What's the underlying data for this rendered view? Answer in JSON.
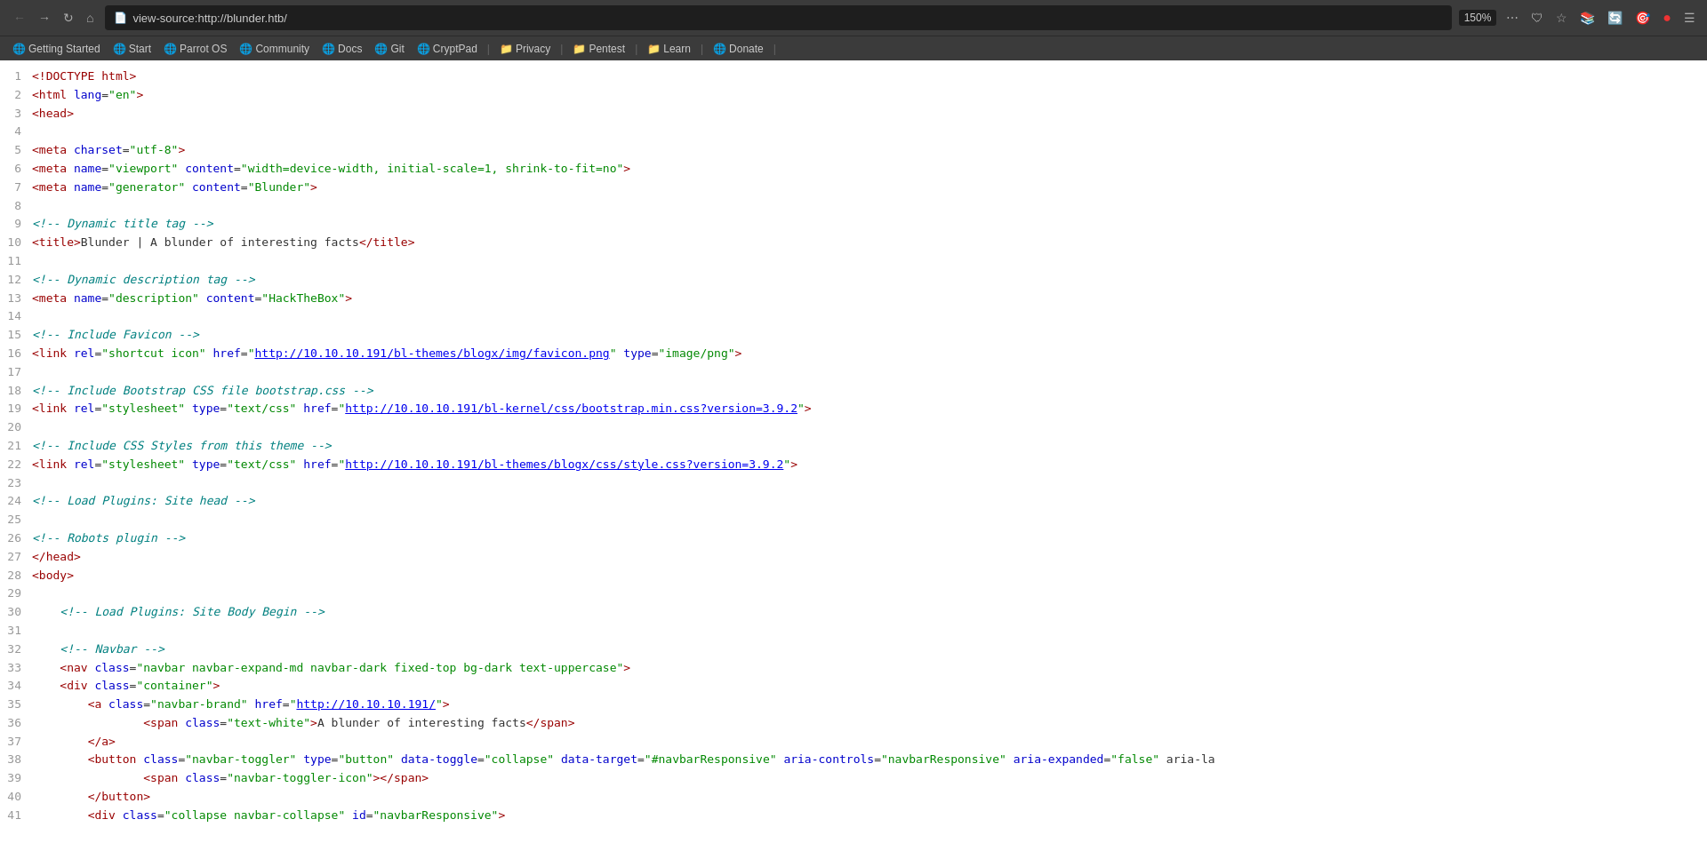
{
  "browser": {
    "address": "view-source:http://blunder.htb/",
    "zoom": "150%",
    "bookmarks": [
      {
        "label": "Getting Started",
        "icon": "🌐"
      },
      {
        "label": "Start",
        "icon": "🌐"
      },
      {
        "label": "Parrot OS",
        "icon": "🌐"
      },
      {
        "label": "Community",
        "icon": "🌐"
      },
      {
        "label": "Docs",
        "icon": "🌐"
      },
      {
        "label": "Git",
        "icon": "🌐"
      },
      {
        "label": "CryptPad",
        "icon": "🌐"
      },
      {
        "separator": true
      },
      {
        "label": "Privacy",
        "icon": "📁"
      },
      {
        "separator": true
      },
      {
        "label": "Pentest",
        "icon": "📁"
      },
      {
        "separator": true
      },
      {
        "label": "Learn",
        "icon": "📁"
      },
      {
        "separator": true
      },
      {
        "label": "Donate",
        "icon": "🌐"
      },
      {
        "separator2": true
      }
    ]
  },
  "source_lines": [
    {
      "n": 1,
      "html": "<span class='doctype'>&lt;!DOCTYPE html&gt;</span>"
    },
    {
      "n": 2,
      "html": "<span class='tag'>&lt;html</span> <span class='attr-name'>lang</span>=<span class='attr-value'>\"en\"</span><span class='tag'>&gt;</span>"
    },
    {
      "n": 3,
      "html": "<span class='tag'>&lt;head&gt;</span>"
    },
    {
      "n": 4,
      "html": ""
    },
    {
      "n": 5,
      "html": "<span class='tag'>&lt;meta</span> <span class='attr-name'>charset</span>=<span class='attr-value'>\"utf-8\"</span><span class='tag'>&gt;</span>"
    },
    {
      "n": 6,
      "html": "<span class='tag'>&lt;meta</span> <span class='attr-name'>name</span>=<span class='attr-value'>\"viewport\"</span> <span class='attr-name'>content</span>=<span class='attr-value'>\"width=device-width, initial-scale=1, shrink-to-fit=no\"</span><span class='tag'>&gt;</span>"
    },
    {
      "n": 7,
      "html": "<span class='tag'>&lt;meta</span> <span class='attr-name'>name</span>=<span class='attr-value'>\"generator\"</span> <span class='attr-name'>content</span>=<span class='attr-value'>\"Blunder\"</span><span class='tag'>&gt;</span>"
    },
    {
      "n": 8,
      "html": ""
    },
    {
      "n": 9,
      "html": "<span class='comment'>&lt;!-- Dynamic title tag --&gt;</span>"
    },
    {
      "n": 10,
      "html": "<span class='tag'>&lt;title&gt;</span>Blunder | A blunder of interesting facts<span class='tag'>&lt;/title&gt;</span>"
    },
    {
      "n": 11,
      "html": ""
    },
    {
      "n": 12,
      "html": "<span class='comment'>&lt;!-- Dynamic description tag --&gt;</span>"
    },
    {
      "n": 13,
      "html": "<span class='tag'>&lt;meta</span> <span class='attr-name'>name</span>=<span class='attr-value'>\"description\"</span> <span class='attr-name'>content</span>=<span class='attr-value'>\"HackTheBox\"</span><span class='tag'>&gt;</span>"
    },
    {
      "n": 14,
      "html": ""
    },
    {
      "n": 15,
      "html": "<span class='comment'>&lt;!-- Include Favicon --&gt;</span>"
    },
    {
      "n": 16,
      "html": "<span class='tag'>&lt;link</span> <span class='attr-name'>rel</span>=<span class='attr-value'>\"shortcut icon\"</span> <span class='attr-name'>href</span>=<span class='attr-value'>\"<a class='url' href='http://10.10.10.191/bl-themes/blogx/img/favicon.png'>http://10.10.10.191/bl-themes/blogx/img/favicon.png</a>\"</span> <span class='attr-name'>type</span>=<span class='attr-value'>\"image/png\"</span><span class='tag'>&gt;</span>"
    },
    {
      "n": 17,
      "html": ""
    },
    {
      "n": 18,
      "html": "<span class='comment'>&lt;!-- Include Bootstrap CSS file bootstrap.css --&gt;</span>"
    },
    {
      "n": 19,
      "html": "<span class='tag'>&lt;link</span> <span class='attr-name'>rel</span>=<span class='attr-value'>\"stylesheet\"</span> <span class='attr-name'>type</span>=<span class='attr-value'>\"text/css\"</span> <span class='attr-name'>href</span>=<span class='attr-value'>\"<a class='url' href='http://10.10.10.191/bl-kernel/css/bootstrap.min.css?version=3.9.2'>http://10.10.10.191/bl-kernel/css/bootstrap.min.css?version=3.9.2</a>\"</span><span class='tag'>&gt;</span>"
    },
    {
      "n": 20,
      "html": ""
    },
    {
      "n": 21,
      "html": "<span class='comment'>&lt;!-- Include CSS Styles from this theme --&gt;</span>"
    },
    {
      "n": 22,
      "html": "<span class='tag'>&lt;link</span> <span class='attr-name'>rel</span>=<span class='attr-value'>\"stylesheet\"</span> <span class='attr-name'>type</span>=<span class='attr-value'>\"text/css\"</span> <span class='attr-name'>href</span>=<span class='attr-value'>\"<a class='url' href='http://10.10.10.191/bl-themes/blogx/css/style.css?version=3.9.2'>http://10.10.10.191/bl-themes/blogx/css/style.css?version=3.9.2</a>\"</span><span class='tag'>&gt;</span>"
    },
    {
      "n": 23,
      "html": ""
    },
    {
      "n": 24,
      "html": "<span class='comment'>&lt;!-- Load Plugins: Site head --&gt;</span>"
    },
    {
      "n": 25,
      "html": ""
    },
    {
      "n": 26,
      "html": "<span class='comment'>&lt;!-- Robots plugin --&gt;</span>"
    },
    {
      "n": 27,
      "html": "<span class='tag'>&lt;/head&gt;</span>"
    },
    {
      "n": 28,
      "html": "<span class='tag'>&lt;body&gt;</span>"
    },
    {
      "n": 29,
      "html": ""
    },
    {
      "n": 30,
      "html": "    <span class='comment'>&lt;!-- Load Plugins: Site Body Begin --&gt;</span>"
    },
    {
      "n": 31,
      "html": ""
    },
    {
      "n": 32,
      "html": "    <span class='comment'>&lt;!-- Navbar --&gt;</span>"
    },
    {
      "n": 33,
      "html": "    <span class='tag'>&lt;nav</span> <span class='attr-name'>class</span>=<span class='attr-value'>\"navbar navbar-expand-md navbar-dark fixed-top bg-dark text-uppercase\"</span><span class='tag'>&gt;</span>"
    },
    {
      "n": 34,
      "html": "    <span class='tag'>&lt;div</span> <span class='attr-name'>class</span>=<span class='attr-value'>\"container\"</span><span class='tag'>&gt;</span>"
    },
    {
      "n": 35,
      "html": "        <span class='tag'>&lt;a</span> <span class='attr-name'>class</span>=<span class='attr-value'>\"navbar-brand\"</span> <span class='attr-name'>href</span>=<span class='attr-value'>\"<a class='url' href='http://10.10.10.191/'>http://10.10.10.191/</a>\"</span><span class='tag'>&gt;</span>"
    },
    {
      "n": 36,
      "html": "                <span class='tag'>&lt;span</span> <span class='attr-name'>class</span>=<span class='attr-value'>\"text-white\"</span><span class='tag'>&gt;</span>A blunder of interesting facts<span class='tag'>&lt;/span&gt;</span>"
    },
    {
      "n": 37,
      "html": "        <span class='tag'>&lt;/a&gt;</span>"
    },
    {
      "n": 38,
      "html": "        <span class='tag'>&lt;button</span> <span class='attr-name'>class</span>=<span class='attr-value'>\"navbar-toggler\"</span> <span class='attr-name'>type</span>=<span class='attr-value'>\"button\"</span> <span class='attr-name'>data-toggle</span>=<span class='attr-value'>\"collapse\"</span> <span class='attr-name'>data-target</span>=<span class='attr-value'>\"#navbarResponsive\"</span> <span class='attr-name'>aria-controls</span>=<span class='attr-value'>\"navbarResponsive\"</span> <span class='attr-name'>aria-expanded</span>=<span class='attr-value'>\"false\"</span> aria-la"
    },
    {
      "n": 39,
      "html": "                <span class='tag'>&lt;span</span> <span class='attr-name'>class</span>=<span class='attr-value'>\"navbar-toggler-icon\"</span><span class='tag'>&gt;&lt;/span&gt;</span>"
    },
    {
      "n": 40,
      "html": "        <span class='tag'>&lt;/button&gt;</span>"
    },
    {
      "n": 41,
      "html": "        <span class='tag'>&lt;div</span> <span class='attr-name'>class</span>=<span class='attr-value'>\"collapse navbar-collapse\"</span> <span class='attr-name'>id</span>=<span class='attr-value'>\"navbarResponsive\"</span><span class='tag'>&gt;</span>"
    }
  ]
}
